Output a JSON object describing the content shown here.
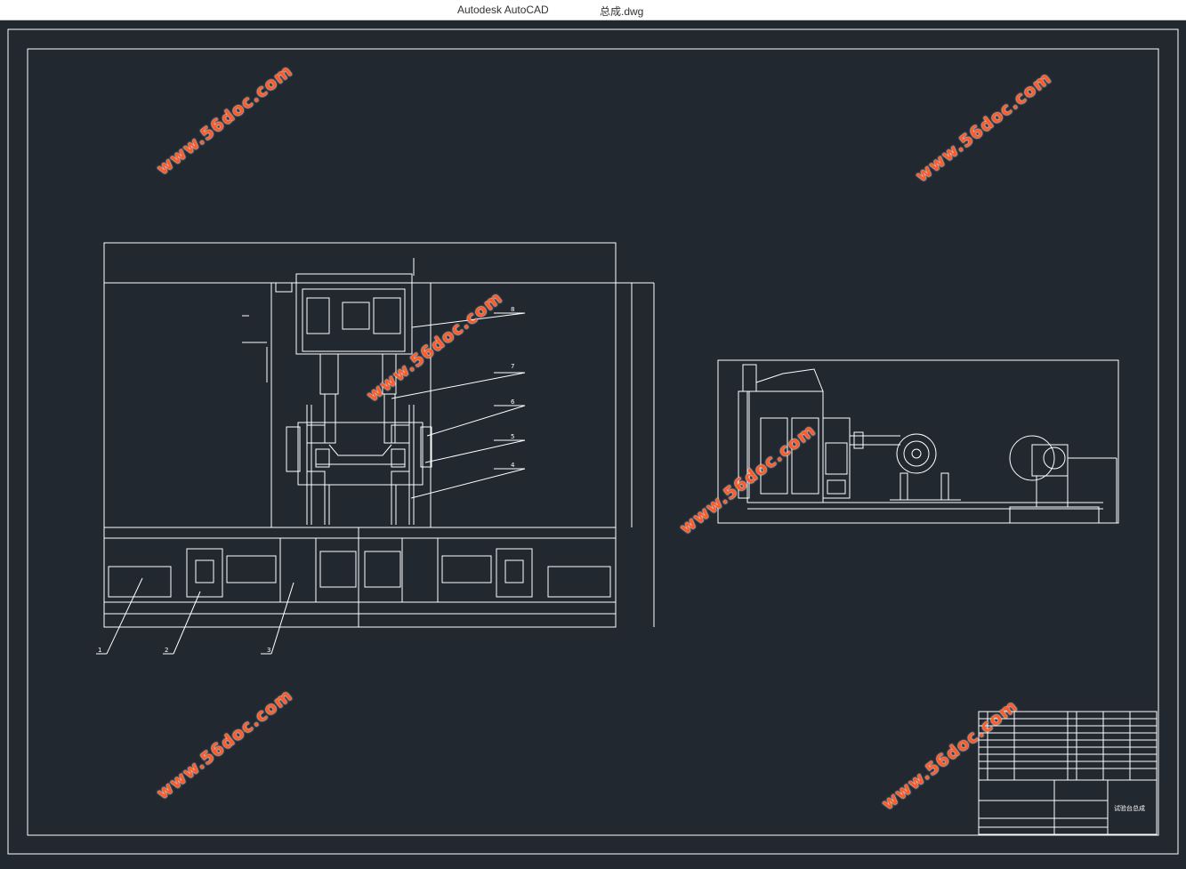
{
  "window": {
    "app_name": "Autodesk AutoCAD",
    "file_name": "总成.dwg"
  },
  "drawing": {
    "part_labels": [
      "1",
      "2",
      "3",
      "4",
      "5",
      "6",
      "7",
      "8"
    ],
    "title_block": {
      "title": "试验台总成"
    },
    "line_color": "#ffffff",
    "background_color": "#212830"
  },
  "watermarks": {
    "text": "www.56doc.com",
    "color": "#ff5a28"
  }
}
